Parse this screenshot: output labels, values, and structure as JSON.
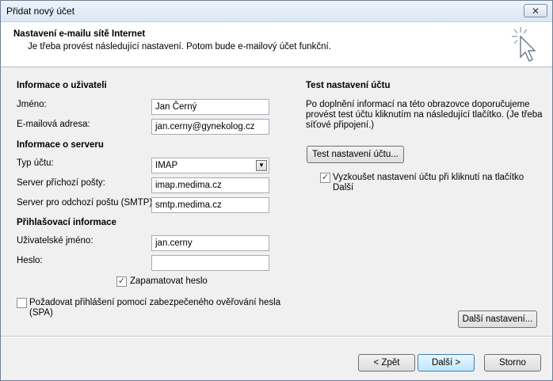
{
  "window": {
    "title": "Přidat nový účet",
    "close_label": "✕"
  },
  "header": {
    "title": "Nastavení e-mailu sítě Internet",
    "subtitle": "Je třeba provést následující nastavení. Potom bude e-mailový účet funkční."
  },
  "user_info": {
    "heading": "Informace o uživateli",
    "name_label": "Jméno:",
    "name_value": "Jan Černý",
    "email_label": "E-mailová adresa:",
    "email_value": "jan.cerny@gynekolog.cz"
  },
  "server_info": {
    "heading": "Informace o serveru",
    "account_type_label": "Typ účtu:",
    "account_type_value": "IMAP",
    "incoming_label": "Server příchozí pošty:",
    "incoming_value": "imap.medima.cz",
    "outgoing_label": "Server pro odchozí poštu (SMTP):",
    "outgoing_value": "smtp.medima.cz"
  },
  "login_info": {
    "heading": "Přihlašovací informace",
    "username_label": "Uživatelské jméno:",
    "username_value": "jan.cerny",
    "password_label": "Heslo:",
    "password_value": "",
    "remember_label": "Zapamatovat heslo",
    "remember_checked": true,
    "spa_label_line1": "Požadovat přihlášení pomocí zabezpečeného ověřování hesla",
    "spa_label_line2": "(SPA)",
    "spa_checked": false
  },
  "test": {
    "heading": "Test nastavení účtu",
    "description_line1": "Po doplnění informací na této obrazovce doporučujeme",
    "description_line2": "provést test účtu kliknutím na následující tlačítko. (Je třeba",
    "description_line3": "síťové připojení.)",
    "test_button": "Test nastavení účtu...",
    "auto_test_line1": "Vyzkoušet nastavení účtu při kliknutí na tlačítko",
    "auto_test_line2": "Další",
    "auto_test_checked": true
  },
  "more_settings_button": "Další nastavení...",
  "footer": {
    "back": "< Zpět",
    "next": "Další >",
    "cancel": "Storno"
  },
  "icons": {
    "check": "✓",
    "dropdown": "▼"
  }
}
